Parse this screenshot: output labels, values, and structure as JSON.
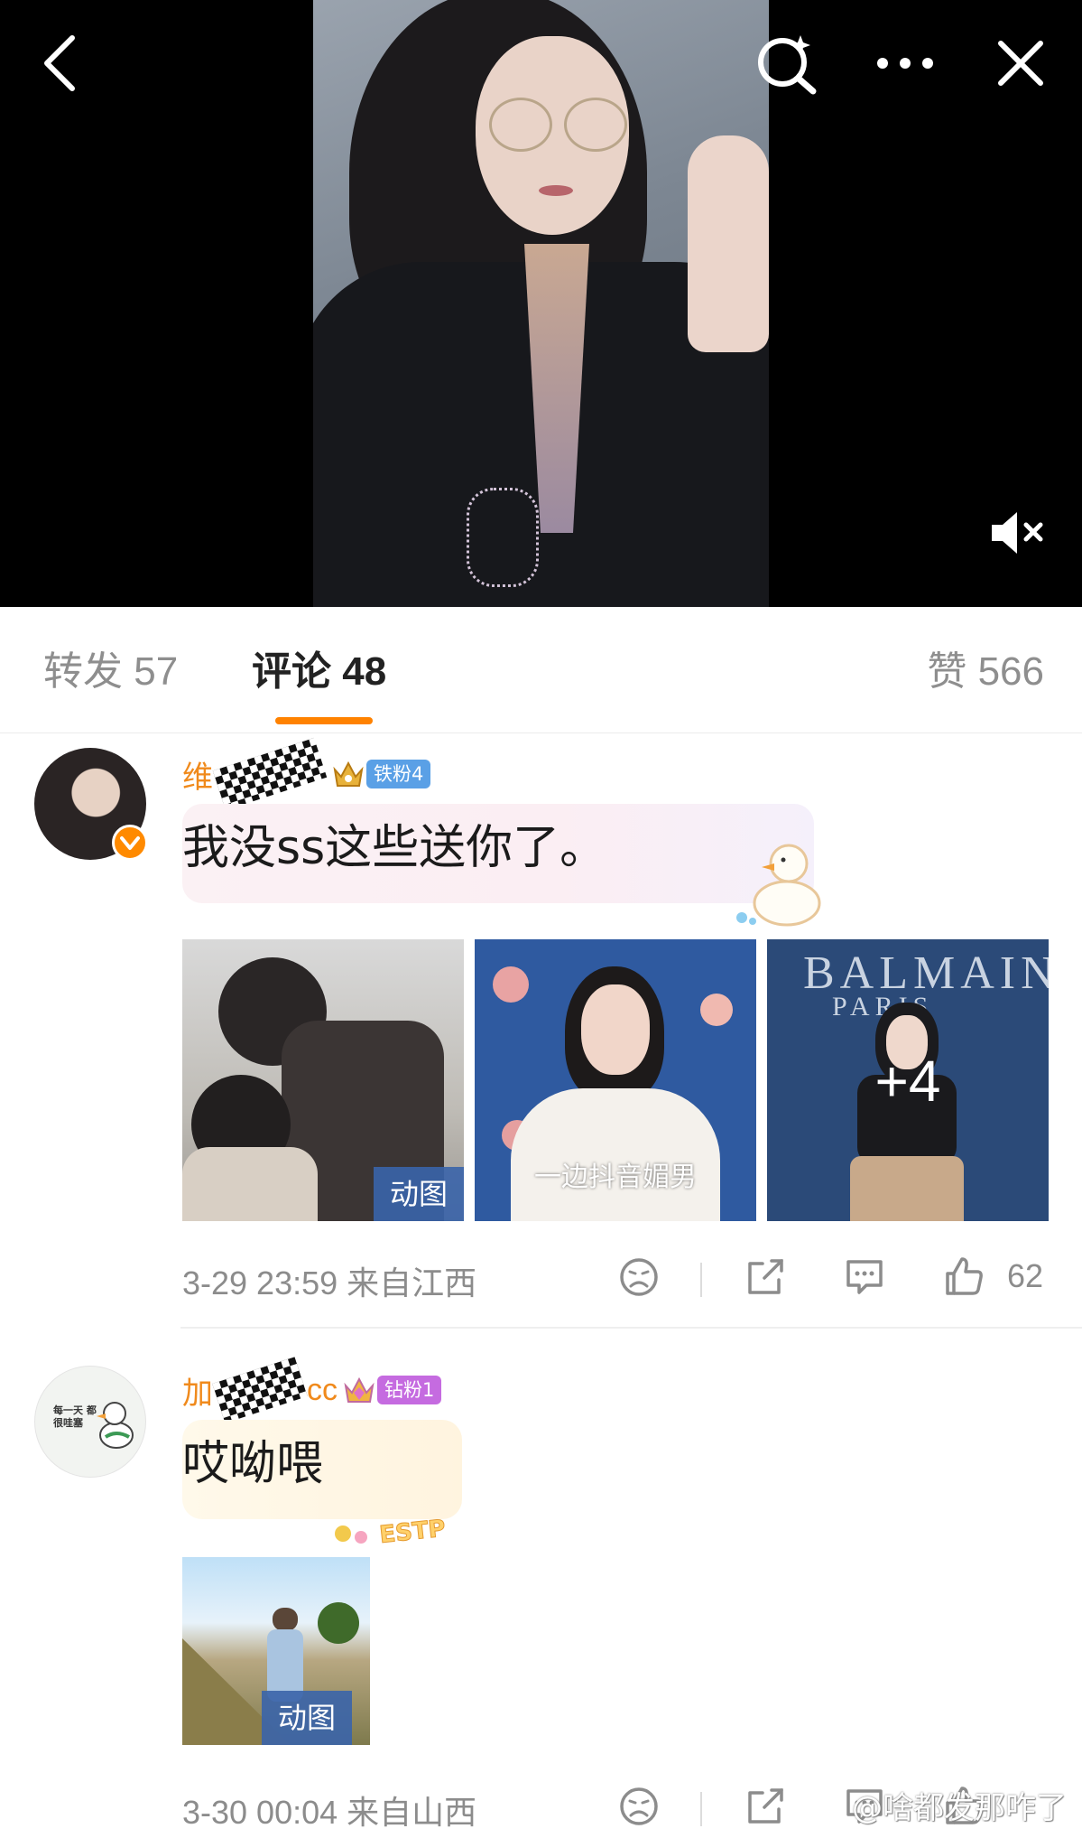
{
  "header": {
    "back_icon": "chevron-left-icon",
    "search_icon": "magic-search-icon",
    "more_icon": "more-dots-icon",
    "close_icon": "close-icon",
    "mute_icon": "speaker-muted-icon"
  },
  "tabs": {
    "repost_label": "转发 57",
    "comment_label": "评论 48",
    "like_label": "赞 566",
    "active": "comment",
    "accent_color": "#ff8200"
  },
  "comments": [
    {
      "user_prefix": "维",
      "user_suffix": "",
      "fan_badge": "铁粉4",
      "verified": true,
      "text": "我没ss这些送你了。",
      "thumbs": [
        {
          "tag": "动图",
          "caption": ""
        },
        {
          "tag": "",
          "caption": "一边抖音媚男"
        },
        {
          "tag": "",
          "caption": "",
          "more": "+4",
          "sign_line1": "BALMAIN",
          "sign_line2": "PARIS"
        }
      ],
      "time_location": "3-29 23:59  来自江西",
      "like_count": "62"
    },
    {
      "user_prefix": "加",
      "user_suffix": "cc",
      "fan_badge": "钻粉1",
      "verified": false,
      "avatar_text": "每一天 都很哇塞",
      "text": "哎呦喂",
      "sticker_text": "ESTP",
      "thumbs": [
        {
          "tag": "动图",
          "caption": ""
        }
      ],
      "time_location": "3-30 00:04  来自山西",
      "watermark": "@啥都发那咋了"
    }
  ],
  "colors": {
    "username": "#f08a1c",
    "fan_iron": "#5aa0e6",
    "fan_diamond": "#c56be0"
  }
}
